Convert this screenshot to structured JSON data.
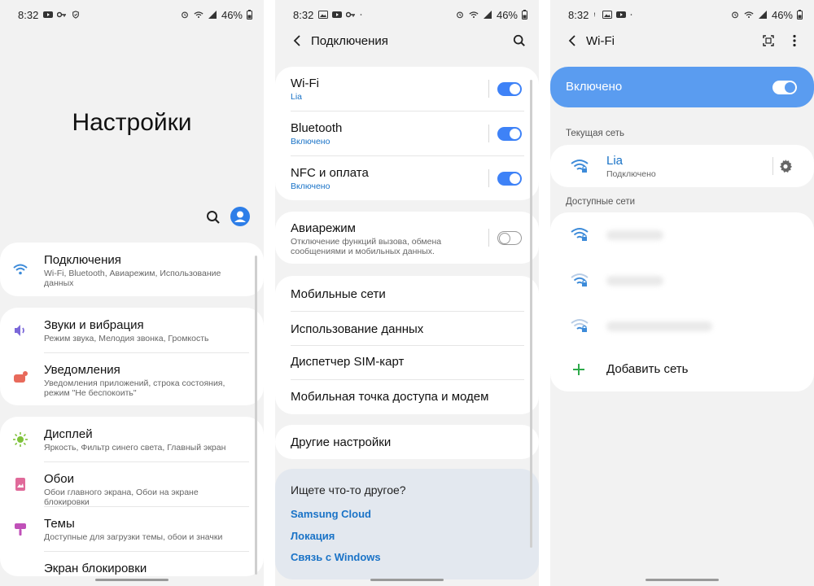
{
  "status_bar": {
    "s1_time": "8:32",
    "s1_battery": "46%",
    "s2_time": "8:32",
    "s2_battery": "46%",
    "s3_time": "8:32",
    "s3_battery": "46%"
  },
  "screen1": {
    "title": "Настройки",
    "items": [
      {
        "label": "Подключения",
        "sub": "Wi-Fi, Bluetooth, Авиарежим, Использование данных",
        "icon": "wifi-icon",
        "color": "#3d8bd9"
      },
      {
        "label": "Звуки и вибрация",
        "sub": "Режим звука, Мелодия звонка, Громкость",
        "icon": "sound-icon",
        "color": "#7b68d9"
      },
      {
        "label": "Уведомления",
        "sub": "Уведомления приложений, строка состояния, режим \"Не беспокоить\"",
        "icon": "notification-icon",
        "color": "#e86a5b"
      },
      {
        "label": "Дисплей",
        "sub": "Яркость, Фильтр синего света, Главный экран",
        "icon": "brightness-icon",
        "color": "#7ec23a"
      },
      {
        "label": "Обои",
        "sub": "Обои главного экрана, Обои на экране блокировки",
        "icon": "wallpaper-icon",
        "color": "#e06a9a"
      },
      {
        "label": "Темы",
        "sub": "Доступные для загрузки темы, обои и значки",
        "icon": "themes-icon",
        "color": "#c050b8"
      },
      {
        "label": "Экран блокировки",
        "sub": "",
        "icon": "lock-icon",
        "color": "#555555"
      }
    ]
  },
  "screen2": {
    "title": "Подключения",
    "toggles": [
      {
        "label": "Wi-Fi",
        "sub": "Lia",
        "state": "on"
      },
      {
        "label": "Bluetooth",
        "sub": "Включено",
        "state": "on"
      },
      {
        "label": "NFC и оплата",
        "sub": "Включено",
        "state": "on"
      }
    ],
    "airplane": {
      "label": "Авиарежим",
      "sub": "Отключение функций вызова, обмена сообщениями и мобильных данных.",
      "state": "off"
    },
    "menu": [
      "Мобильные сети",
      "Использование данных",
      "Диспетчер SIM-карт",
      "Мобильная точка доступа и модем"
    ],
    "other": "Другие настройки",
    "suggest": {
      "title": "Ищете что-то другое?",
      "links": [
        "Samsung Cloud",
        "Локация",
        "Связь с Windows"
      ]
    }
  },
  "screen3": {
    "title": "Wi-Fi",
    "master": {
      "label": "Включено",
      "state": "on"
    },
    "current_header": "Текущая сеть",
    "current": {
      "name": "Lia",
      "status": "Подключено"
    },
    "available_header": "Доступные сети",
    "add_network": "Добавить сеть"
  },
  "colors": {
    "accent": "#3e82f7",
    "link": "#1a73c7",
    "master_bar": "#5a9cf0"
  }
}
